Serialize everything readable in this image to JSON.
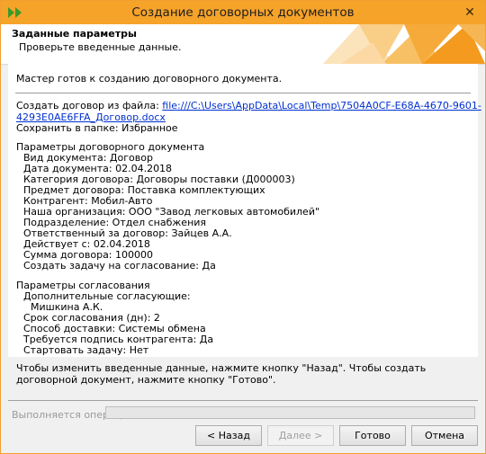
{
  "window": {
    "title": "Создание договорных документов"
  },
  "header": {
    "title": "Заданные параметры",
    "subtitle": "Проверьте введенные данные."
  },
  "intro": "Мастер готов к созданию договорного документа.",
  "file": {
    "label": "Создать договор из файла: ",
    "link_line1": "file:///C:\\Users\\AppData\\Local\\Temp\\7504A0CF-E68A-4670-9601-",
    "link_line2": "4293E0AE6FFA_Договор.docx",
    "folder": "Сохранить в папке: Избранное"
  },
  "contract_params": {
    "heading": "Параметры договорного документа",
    "items": [
      "Вид документа: Договор",
      "Дата документа: 02.04.2018",
      "Категория договора: Договоры поставки (Д000003)",
      "Предмет договора: Поставка комплектующих",
      "Контрагент: Мобил-Авто",
      "Наша организация: ООО \"Завод легковых автомобилей\"",
      "Подразделение: Отдел снабжения",
      "Ответственный за договор: Зайцев А.А.",
      "Действует с: 02.04.2018",
      "Сумма договора: 100000",
      "Создать задачу на согласование: Да"
    ]
  },
  "approval_params": {
    "heading": "Параметры согласования",
    "approvers_label": "Дополнительные согласующие:",
    "approver": "Мишкина А.К.",
    "items": [
      "Срок согласования (дн): 2",
      "Способ доставки: Системы обмена",
      "Требуется подпись контрагента: Да",
      "Стартовать задачу: Нет"
    ]
  },
  "bottom_text": "Чтобы изменить введенные данные, нажмите кнопку \"Назад\". Чтобы создать договорной документ, нажмите кнопку \"Готово\".",
  "progress": {
    "label": "Выполняется операция",
    "value": 0
  },
  "buttons": {
    "back": "< Назад",
    "next": "Далее >",
    "finish": "Готово",
    "cancel": "Отмена"
  },
  "colors": {
    "title_bar": "#f6a32a",
    "link": "#0030d0",
    "accent_green": "#3a9a2a"
  }
}
